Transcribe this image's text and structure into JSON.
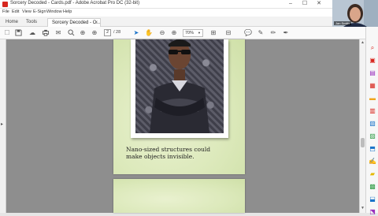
{
  "window": {
    "title": "Sorcery Decoded - Cards.pdf - Adobe Acrobat Pro DC (32-bit)",
    "controls": [
      "–",
      "☐",
      "✕"
    ]
  },
  "menu": [
    "File",
    "Edit",
    "View",
    "E-Sign",
    "Window",
    "Help"
  ],
  "tabs": [
    {
      "label": "Home"
    },
    {
      "label": "Tools"
    },
    {
      "label": "Sorcery Decoded - C...",
      "close": "×"
    }
  ],
  "toolbar": {
    "page_current": "2",
    "page_total": "/ 28",
    "zoom": "70%"
  },
  "document": {
    "caption_line1": "Nano-sized structures could",
    "caption_line2": "make objects invisible."
  },
  "webcam": {
    "name": "Jan Smith"
  },
  "colors": {
    "accent": "#d7261e",
    "page_bg": "#dce9bb",
    "doc_bg": "#8e8e8e"
  }
}
